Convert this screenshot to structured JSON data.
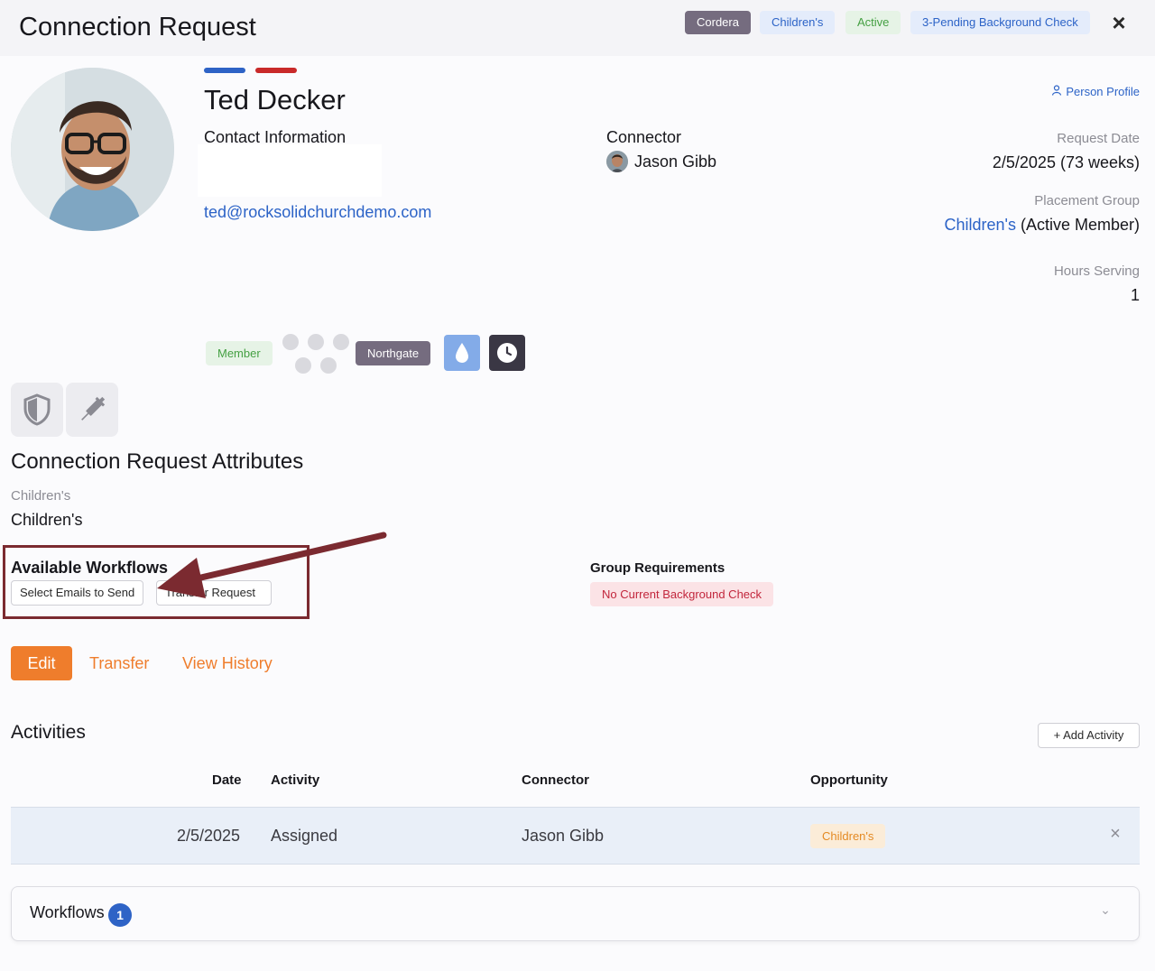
{
  "header": {
    "title": "Connection Request",
    "pills": [
      "Cordera",
      "Children's",
      "Active",
      "3-Pending Background Check"
    ],
    "close_icon": "close-icon"
  },
  "person": {
    "name": "Ted Decker",
    "contact_heading": "Contact Information",
    "email": "ted@rocksolidchurchdemo.com",
    "connector_heading": "Connector",
    "connector_name": "Jason Gibb",
    "profile_link": "Person Profile",
    "badges": {
      "member": "Member",
      "campus": "Northgate"
    },
    "icons": [
      "baptism-drop-icon",
      "clock-icon",
      "shield-icon",
      "syringe-icon"
    ]
  },
  "details": {
    "request_date_label": "Request Date",
    "request_date_value": "2/5/2025 (73 weeks)",
    "placement_label": "Placement Group",
    "placement_group": "Children's",
    "placement_status": "(Active Member)",
    "hours_label": "Hours Serving",
    "hours_value": "1"
  },
  "attributes": {
    "heading": "Connection Request Attributes",
    "label": "Children's",
    "value": "Children's"
  },
  "workflows": {
    "heading": "Available Workflows",
    "buttons": [
      "Select Emails to Send",
      "Transfer Request"
    ]
  },
  "group_requirements": {
    "heading": "Group Requirements",
    "badge": "No Current Background Check"
  },
  "actions": {
    "edit": "Edit",
    "transfer": "Transfer",
    "history": "View History"
  },
  "activities": {
    "heading": "Activities",
    "add_label": "Add Activity",
    "columns": [
      "Date",
      "Activity",
      "Connector",
      "Opportunity"
    ],
    "rows": [
      {
        "date": "2/5/2025",
        "activity": "Assigned",
        "connector": "Jason Gibb",
        "opportunity": "Children's"
      }
    ]
  },
  "workflows_panel": {
    "label": "Workflows",
    "count": "1"
  },
  "colors": {
    "accent_orange": "#ef7d2c",
    "link_blue": "#2c63c7",
    "annotation": "#7b2a30"
  }
}
